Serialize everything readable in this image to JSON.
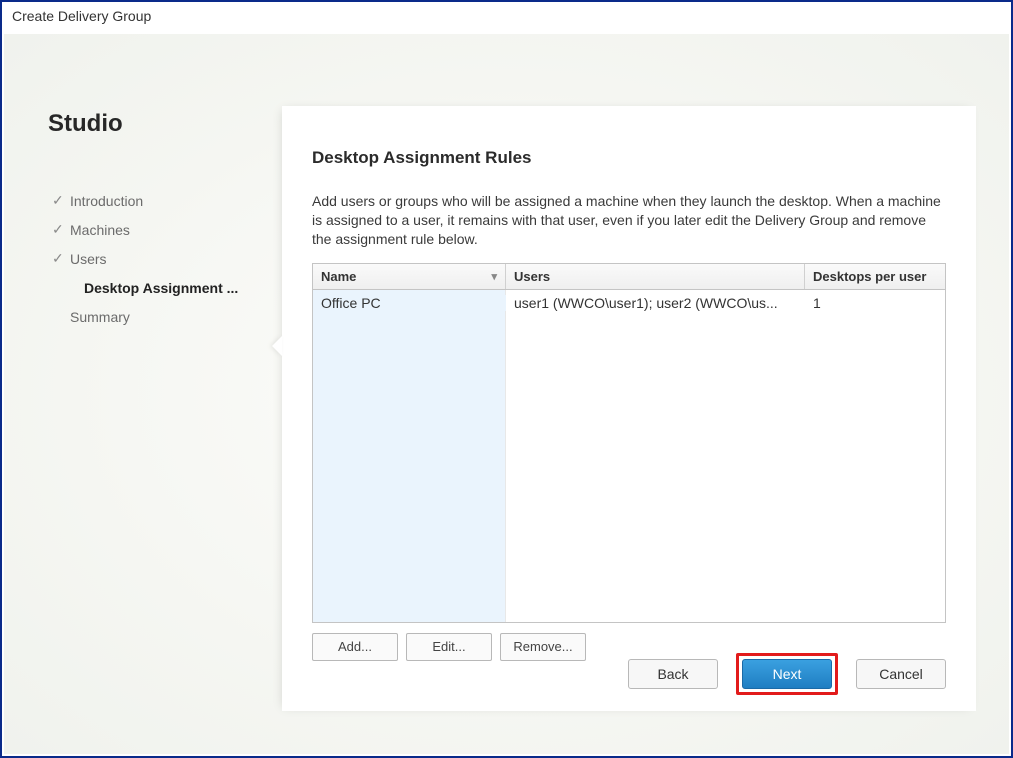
{
  "window": {
    "title": "Create Delivery Group"
  },
  "sidebar": {
    "brand": "Studio",
    "items": [
      {
        "label": "Introduction",
        "completed": true
      },
      {
        "label": "Machines",
        "completed": true
      },
      {
        "label": "Users",
        "completed": true
      },
      {
        "label": "Desktop Assignment ...",
        "current": true
      },
      {
        "label": "Summary"
      }
    ]
  },
  "panel": {
    "heading": "Desktop Assignment Rules",
    "description": "Add users or groups who will be assigned a machine when they launch the desktop. When a machine is assigned to a user, it remains with that user, even if you later edit the Delivery Group and remove the assignment rule below."
  },
  "table": {
    "columns": {
      "name": "Name",
      "users": "Users",
      "dpu": "Desktops per user"
    },
    "rows": [
      {
        "name": "Office PC",
        "users": "user1 (WWCO\\user1); user2 (WWCO\\us...",
        "dpu": "1"
      }
    ]
  },
  "actions": {
    "add": "Add...",
    "edit": "Edit...",
    "remove": "Remove..."
  },
  "wizard": {
    "back": "Back",
    "next": "Next",
    "cancel": "Cancel"
  }
}
